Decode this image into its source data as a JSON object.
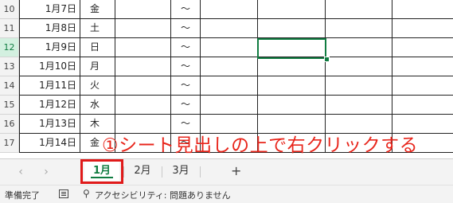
{
  "rows": [
    {
      "num": "10",
      "date": "1月7日",
      "day": "金",
      "tilde": "～",
      "active": false
    },
    {
      "num": "11",
      "date": "1月8日",
      "day": "土",
      "tilde": "～",
      "active": false
    },
    {
      "num": "12",
      "date": "1月9日",
      "day": "日",
      "tilde": "～",
      "active": true
    },
    {
      "num": "13",
      "date": "1月10日",
      "day": "月",
      "tilde": "～",
      "active": false
    },
    {
      "num": "14",
      "date": "1月11日",
      "day": "火",
      "tilde": "～",
      "active": false
    },
    {
      "num": "15",
      "date": "1月12日",
      "day": "水",
      "tilde": "～",
      "active": false
    },
    {
      "num": "16",
      "date": "1月13日",
      "day": "木",
      "tilde": "～",
      "active": false
    },
    {
      "num": "17",
      "date": "1月14日",
      "day": "金",
      "tilde": "～",
      "active": false
    }
  ],
  "annotation": "①シート見出しの上で右クリックする",
  "tabs": {
    "prev": "‹",
    "next": "›",
    "sheets": [
      "1月",
      "2月",
      "3月"
    ],
    "add": "+"
  },
  "status": {
    "ready": "準備完了",
    "accessibility": "アクセシビリティ: 問題ありません"
  },
  "colors": {
    "accent": "#107c41",
    "annotation": "#e8261c",
    "highlight": "#e01a1a"
  }
}
